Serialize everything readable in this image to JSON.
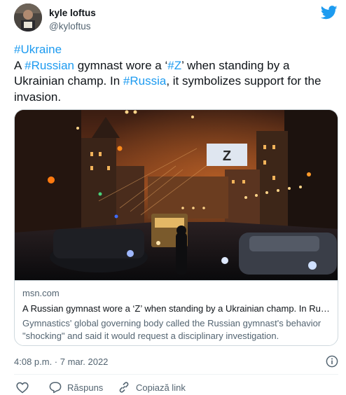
{
  "author": {
    "name": "kyle loftus",
    "handle": "@kyloftus"
  },
  "tweet": {
    "line1_tag": "#Ukraine",
    "p_a": "A ",
    "tag_russian": "#Russian",
    "p_b": " gymnast wore a ‘",
    "tag_z": "#Z",
    "p_c": "’ when standing by a Ukrainian champ. In ",
    "tag_russia": "#Russia",
    "p_d": ", it symbolizes support for the invasion."
  },
  "card": {
    "billboard_text": "Z",
    "domain": "msn.com",
    "title": "A Russian gymnast wore a ‘Z’ when standing by a Ukrainian champ. In Russia, it symbolizes support for the invasion.",
    "description": "Gymnastics' global governing body called the Russian gymnast's behavior \"shocking\" and said it would request a disciplinary investigation."
  },
  "timestamp": "4:08 p.m. · 7 mar. 2022",
  "actions": {
    "reply": "Răspuns",
    "copy_link": "Copiază link"
  },
  "colors": {
    "link": "#1d9bf0",
    "secondary_text": "#536471",
    "border": "#cfd9de"
  },
  "icons": [
    "twitter-bird-icon",
    "info-icon",
    "heart-icon",
    "reply-bubble-icon",
    "link-icon"
  ]
}
